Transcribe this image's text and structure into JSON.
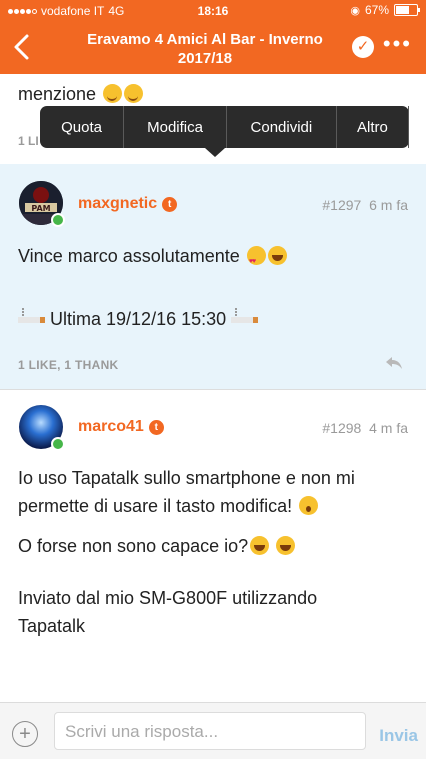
{
  "status_bar": {
    "carrier": "vodafone IT",
    "network": "4G",
    "time": "18:16",
    "battery": "67%",
    "battery_level": 0.67
  },
  "header": {
    "title": "Eravamo 4 Amici Al Bar - Inverno 2017/18",
    "back_icon": "chevron-left-icon",
    "check_icon": "check-icon",
    "more_icon": "more-icon"
  },
  "context_menu": {
    "items": [
      "Quota",
      "Modifica",
      "Condividi",
      "Altro"
    ]
  },
  "previous_post": {
    "text_fragment": "menzione",
    "likes_text": "1 LI"
  },
  "posts": [
    {
      "username": "maxgnetic",
      "number": "#1297",
      "time": "6 m fa",
      "line1": "Vince marco assolutamente",
      "line2": "Ultima 19/12/16 15:30",
      "likes": "1 LIKE, 1 THANK",
      "badge_color": "#f26822"
    },
    {
      "username": "marco41",
      "number": "#1298",
      "time": "4 m fa",
      "line1": "Io uso Tapatalk sullo smartphone e non mi",
      "line2": "permette di usare il tasto modifica!",
      "line3": "O forse non sono capace io?",
      "line4": "Inviato dal mio SM-G800F utilizzando",
      "line5": "Tapatalk"
    }
  ],
  "reply_bar": {
    "placeholder": "Scrivi una risposta...",
    "send": "Invia"
  },
  "colors": {
    "accent": "#f26822",
    "highlight": "#e8f4fb",
    "send": "#9ac6e6"
  }
}
